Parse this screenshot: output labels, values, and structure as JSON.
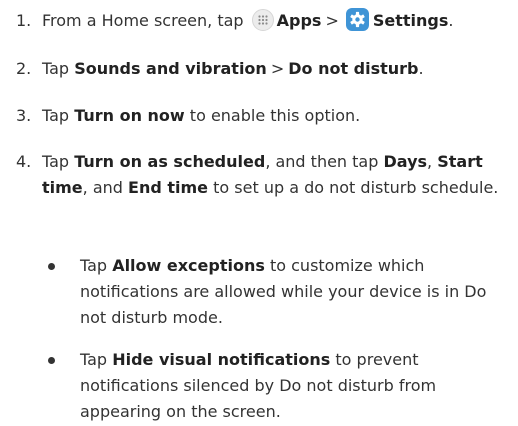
{
  "steps": [
    {
      "num": "1.",
      "pre": "From a Home screen, tap",
      "apps_label": "Apps",
      "sep": ">",
      "settings_label": "Settings",
      "end": "."
    },
    {
      "num": "2.",
      "pre": "Tap",
      "bold1": "Sounds and vibration",
      "sep": ">",
      "bold2": "Do not disturb",
      "end": "."
    },
    {
      "num": "3.",
      "pre": "Tap",
      "bold1": "Turn on now",
      "post": "to enable this option."
    },
    {
      "num": "4.",
      "pre": "Tap",
      "bold1": "Turn on as scheduled",
      "mid1": ", and then tap",
      "bold2": "Days",
      "mid2": ",",
      "bold3": "Start time",
      "mid3": ", and",
      "bold4": "End time",
      "post": "to set up a do not disturb schedule."
    }
  ],
  "bullets": [
    {
      "pre": "Tap",
      "bold": "Allow exceptions",
      "post": "to customize which notifications are allowed while your device is in Do not disturb mode."
    },
    {
      "pre": "Tap",
      "bold": "Hide visual notifications",
      "post": "to prevent notifications silenced by Do not disturb from appearing on the screen."
    }
  ],
  "icons": {
    "apps": "apps-grid-icon",
    "settings": "settings-gear-icon",
    "settings_color": "#3f94d6"
  }
}
